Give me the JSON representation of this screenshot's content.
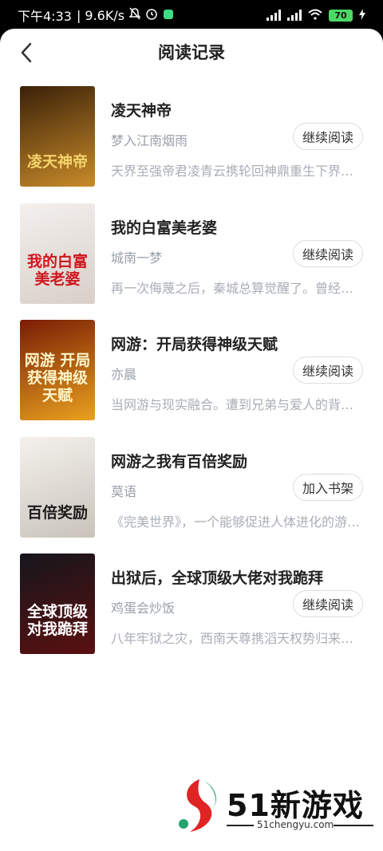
{
  "status_bar": {
    "time": "下午4:33",
    "speed": "| 9.6K/s",
    "battery": "70"
  },
  "header": {
    "back_icon": "chevron-left-icon",
    "title": "阅读记录"
  },
  "books": [
    {
      "title": "凌天神帝",
      "author": "梦入江南烟雨",
      "desc": "天界至强帝君凌青云携轮回神鼎重生下界……",
      "button": "继续阅读",
      "cover_text": "凌天神帝",
      "cover_colors": [
        "#3a2108",
        "#c98b2a"
      ]
    },
    {
      "title": "我的白富美老婆",
      "author": "城南一梦",
      "desc": "再一次侮蔑之后，秦城总算觉醒了。曾经……",
      "button": "继续阅读",
      "cover_text": "我的白富美老婆",
      "cover_colors": [
        "#f3f0ee",
        "#d8cfc8"
      ]
    },
    {
      "title": "网游：开局获得神级天赋",
      "author": "亦晨",
      "desc": "当网游与现实融合。遭到兄弟与爱人的背叛……",
      "button": "继续阅读",
      "cover_text": "网游 开局获得神级天赋",
      "cover_colors": [
        "#7a1c05",
        "#e8a21f"
      ]
    },
    {
      "title": "网游之我有百倍奖励",
      "author": "莫语",
      "desc": "《完美世界》，一个能够促进人体进化的游戏……",
      "button": "加入书架",
      "cover_text": "百倍奖励",
      "cover_colors": [
        "#f4f1ec",
        "#c9c3bb"
      ]
    },
    {
      "title": "出狱后，全球顶级大佬对我跪拜",
      "author": "鸡蛋会炒饭",
      "desc": "八年牢狱之灾，西南天尊携滔天权势归来……",
      "button": "继续阅读",
      "cover_text": "全球顶级 对我跪拜",
      "cover_colors": [
        "#15161c",
        "#5b1010"
      ]
    }
  ],
  "watermark": {
    "brand": "51新游戏",
    "url": "51chengyu.com"
  }
}
